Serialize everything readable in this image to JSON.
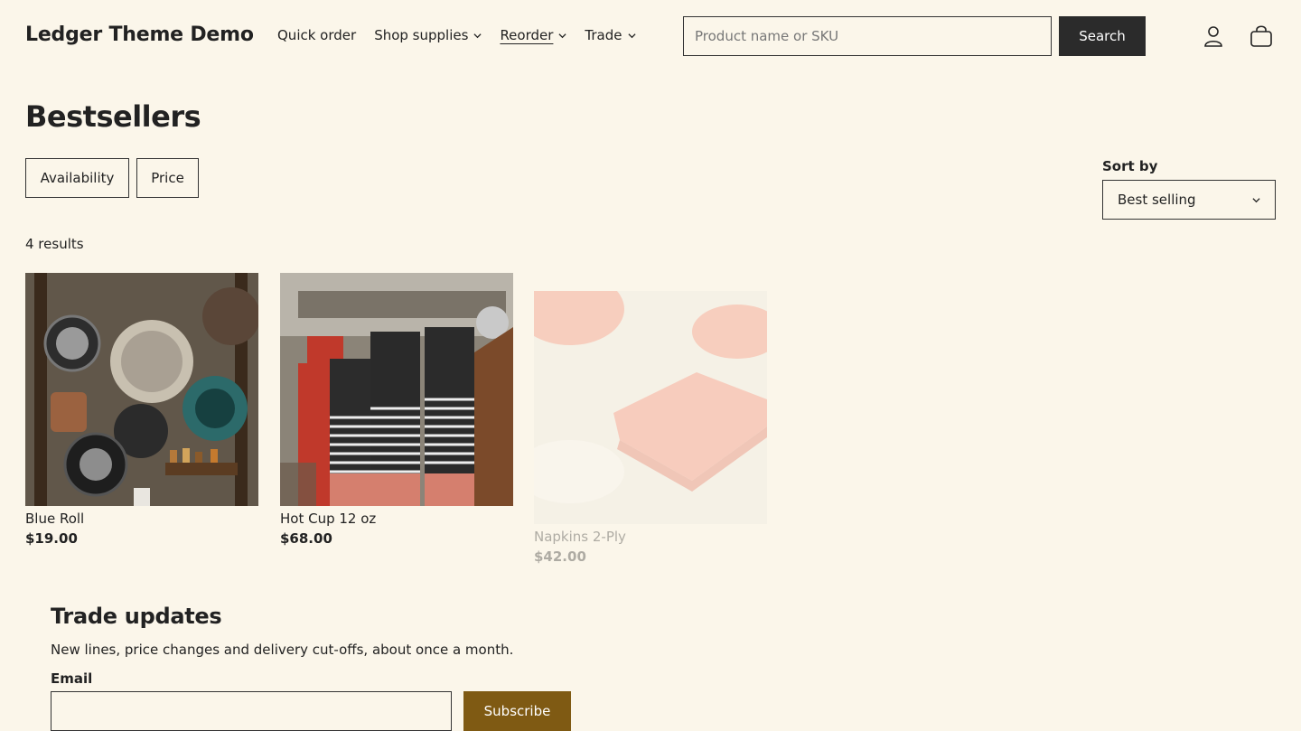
{
  "header": {
    "brand": "Ledger Theme Demo",
    "nav": [
      {
        "label": "Quick order"
      },
      {
        "label": "Shop supplies"
      },
      {
        "label": "Reorder"
      },
      {
        "label": "Trade"
      }
    ],
    "search": {
      "placeholder": "Product name or SKU",
      "button_label": "Search"
    },
    "icons": {
      "account": "user-icon",
      "cart": "bag-icon"
    }
  },
  "collection": {
    "title": "Bestsellers",
    "filters": [
      "Availability",
      "Price"
    ],
    "sort": {
      "label": "Sort by",
      "selected": "Best selling"
    },
    "results_text": "4 results",
    "products": [
      {
        "name": "Blue Roll",
        "price": "$19.00"
      },
      {
        "name": "Hot Cup 12 oz",
        "price": "$68.00"
      },
      {
        "name": "Napkins 2-Ply",
        "price": "$42.00"
      }
    ]
  },
  "newsletter": {
    "title": "Trade updates",
    "description": "New lines, price changes and delivery cut-offs, about once a month.",
    "email_label": "Email",
    "button_label": "Subscribe"
  },
  "colors": {
    "background": "#fbf6ea",
    "accent": "#7f5a13",
    "dark_button": "#2b2b2b"
  }
}
